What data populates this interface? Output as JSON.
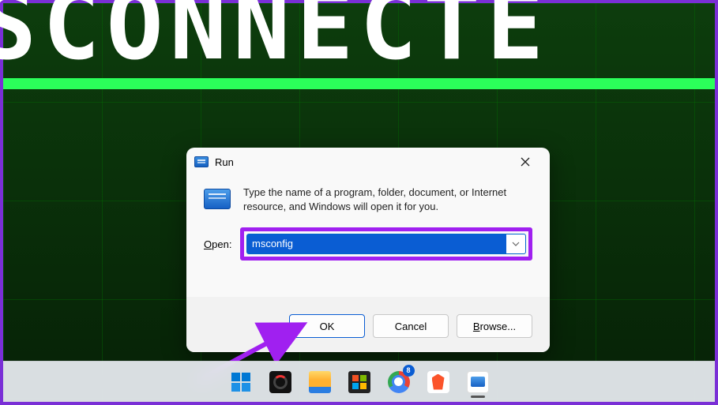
{
  "wallpaper": {
    "partial_text": "SCONNECTE"
  },
  "dialog": {
    "title": "Run",
    "description": "Type the name of a program, folder, document, or Internet resource, and Windows will open it for you.",
    "open_label": "Open:",
    "input_value": "msconfig",
    "buttons": {
      "ok": "OK",
      "cancel": "Cancel",
      "browse": "Browse..."
    }
  },
  "taskbar": {
    "chrome_badge": "8"
  },
  "colors": {
    "highlight": "#a020f0",
    "accent_blue": "#0a5dd3",
    "green_bar": "#2bff5a"
  }
}
